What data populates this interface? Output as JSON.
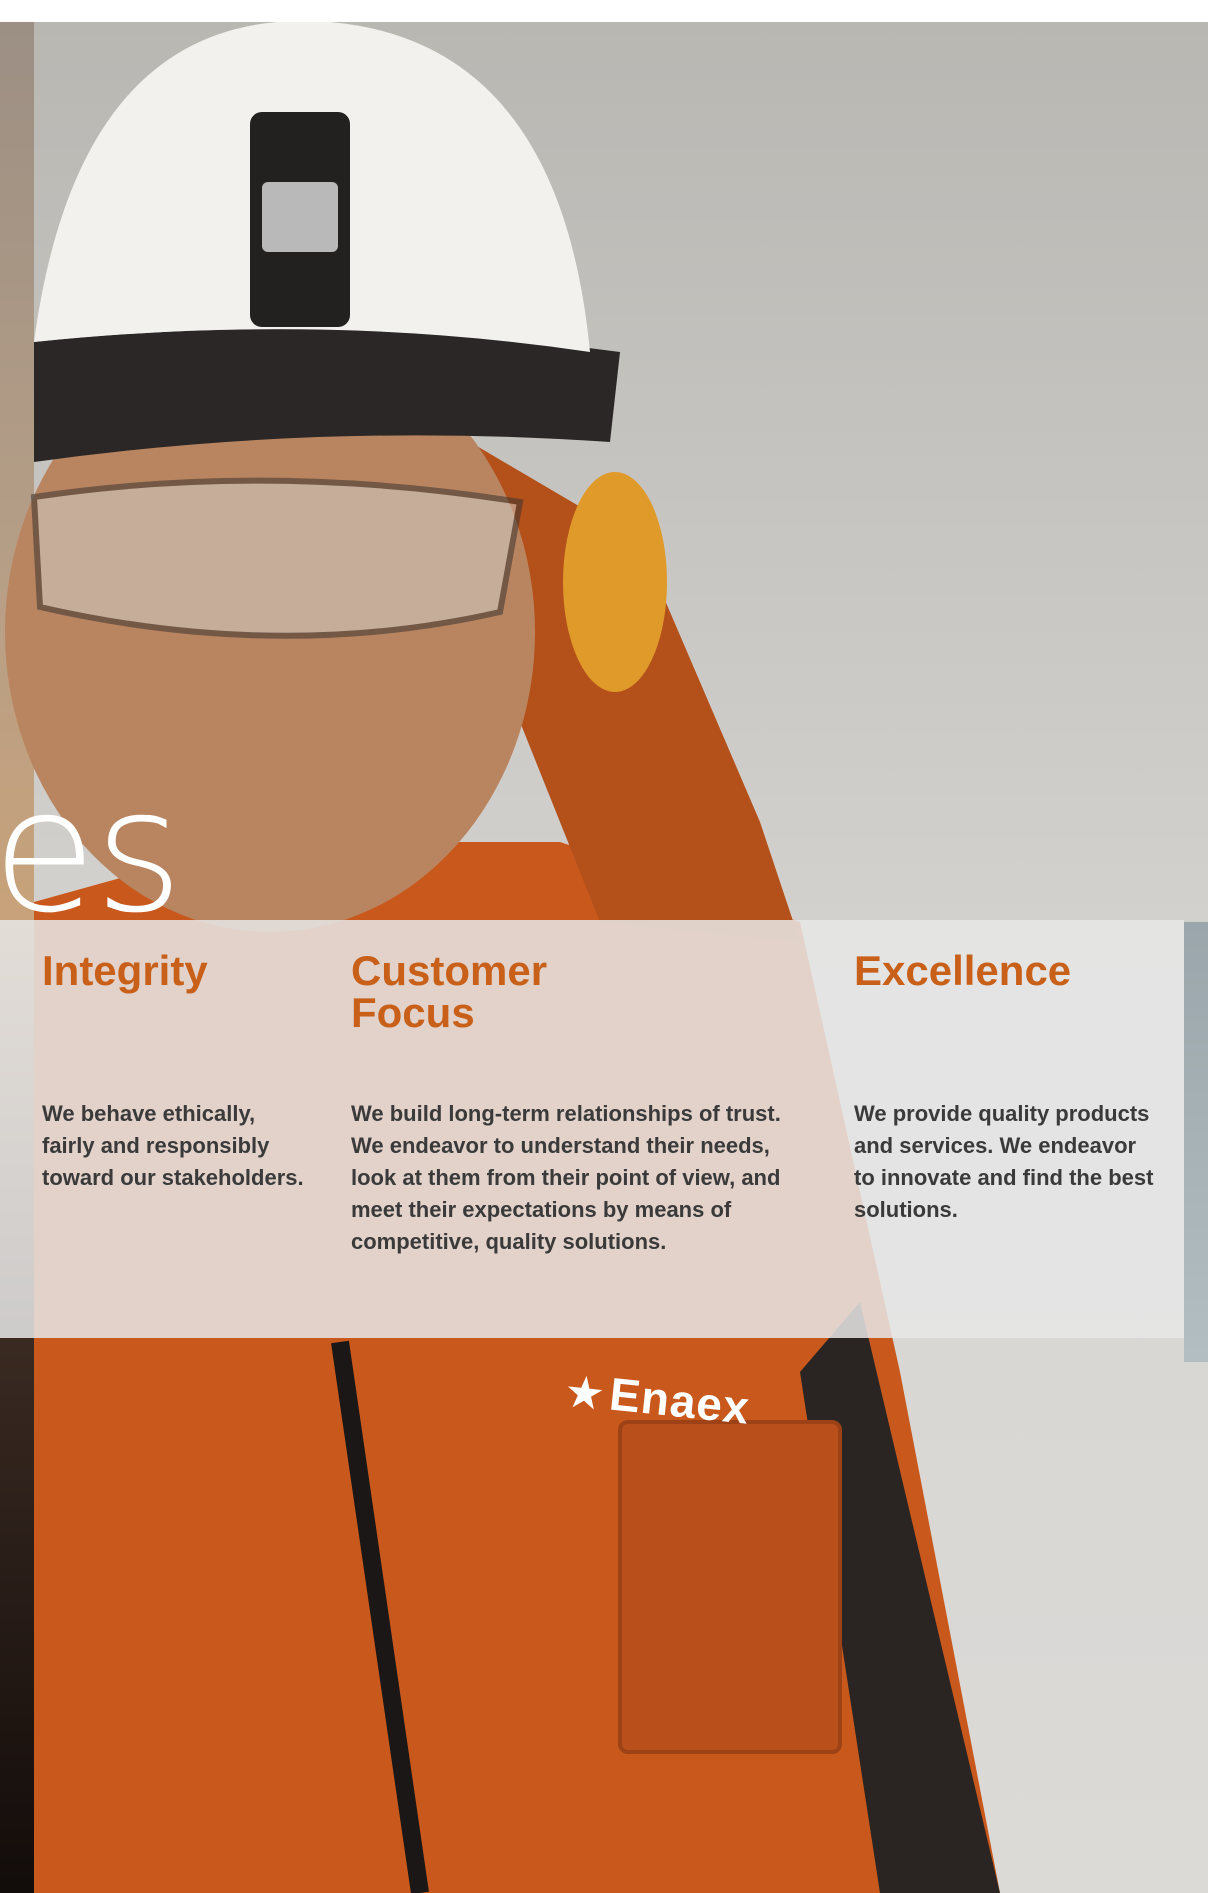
{
  "page": {
    "heading_fragment": "es"
  },
  "values": [
    {
      "title": "Integrity",
      "description": "We behave ethically, fairly and responsibly toward our stakeholders."
    },
    {
      "title": "Customer Focus",
      "description": "We build long-term relationships of trust. We endeavor to understand their needs, look at them from their point of view, and meet their expectations by means of competitive, quality solutions."
    },
    {
      "title": "Excellence",
      "description": "We provide quality products and services. We endeavor to innovate and find the best solutions."
    }
  ],
  "logo": {
    "text": "Enaex",
    "icon": "star-logo-icon"
  },
  "colors": {
    "accent": "#c8601a",
    "body_text": "#3a3a3a",
    "band": "#e6e6e6"
  }
}
